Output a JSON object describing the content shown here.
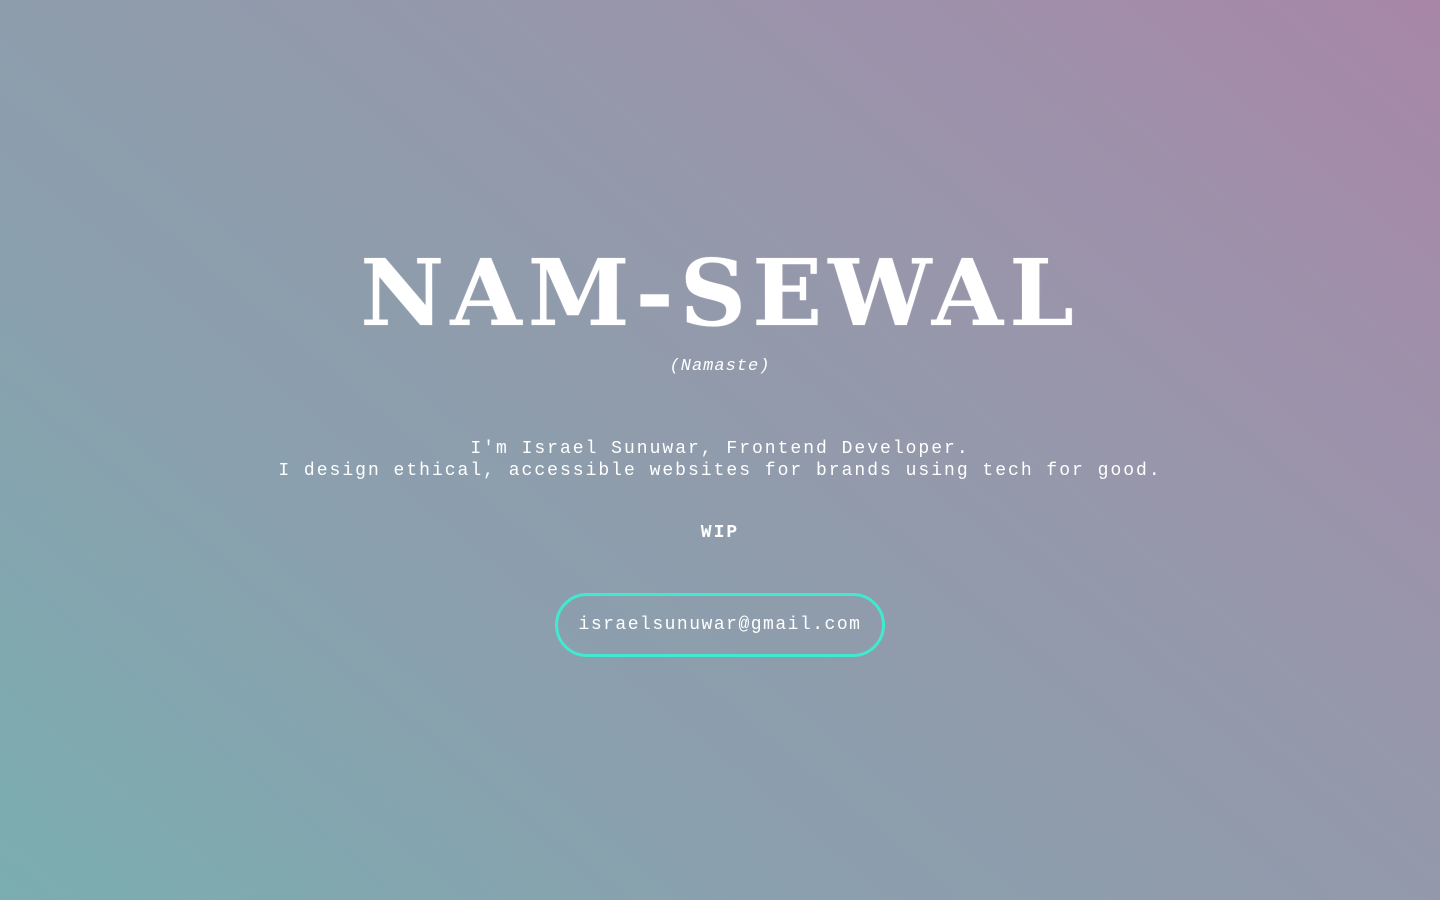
{
  "hero": {
    "title": "NAM-SEWAL",
    "subtitle": "(Namaste)"
  },
  "intro": {
    "line1": "I'm Israel Sunuwar, Frontend Developer.",
    "line2": "I design ethical, accessible websites for brands using tech for good."
  },
  "status": {
    "label": "WIP"
  },
  "contact": {
    "email": "israelsunuwar@gmail.com"
  },
  "colors": {
    "accent": "#40e9cf",
    "gradient_start": "#7aaeb0",
    "gradient_end": "#a886a8",
    "text": "#ffffff"
  }
}
